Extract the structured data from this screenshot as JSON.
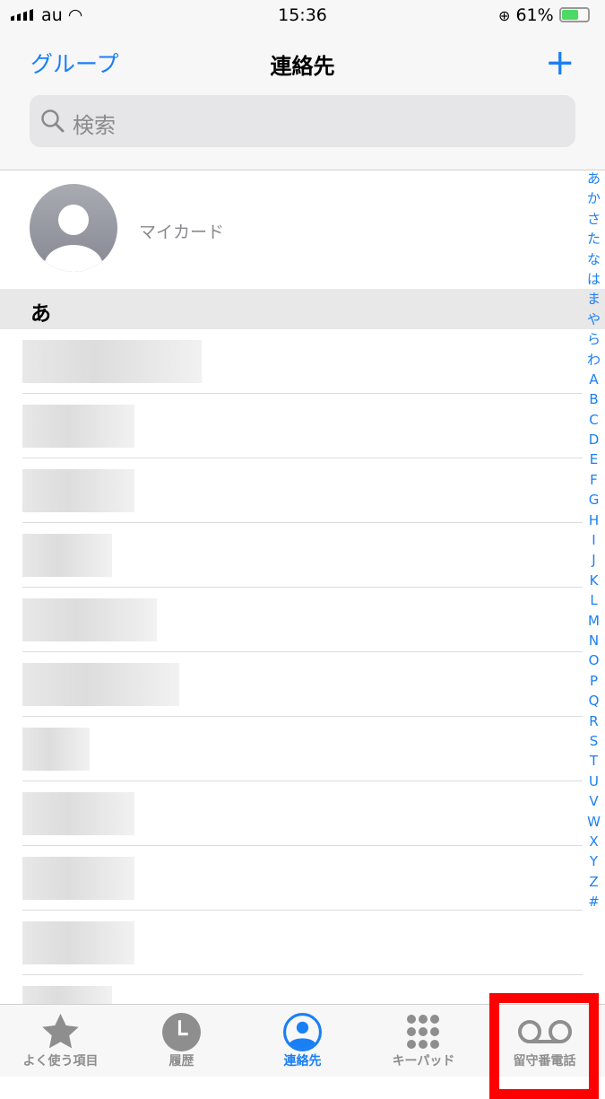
{
  "status": {
    "carrier": "au",
    "time": "15:36",
    "battery": "61%"
  },
  "nav": {
    "left": "グループ",
    "title": "連絡先",
    "add_icon": "plus-icon"
  },
  "search": {
    "placeholder": "検索"
  },
  "my_card": {
    "label": "マイカード"
  },
  "section": "あ",
  "index": [
    "あ",
    "か",
    "さ",
    "た",
    "な",
    "は",
    "ま",
    "や",
    "ら",
    "わ",
    "A",
    "B",
    "C",
    "D",
    "E",
    "F",
    "G",
    "H",
    "I",
    "J",
    "K",
    "L",
    "M",
    "N",
    "O",
    "P",
    "Q",
    "R",
    "S",
    "T",
    "U",
    "V",
    "W",
    "X",
    "Y",
    "Z",
    "#"
  ],
  "tabs": [
    {
      "label": "よく使う項目",
      "icon": "star-icon"
    },
    {
      "label": "履歴",
      "icon": "clock-icon"
    },
    {
      "label": "連絡先",
      "icon": "person-circle-icon",
      "active": true
    },
    {
      "label": "キーパッド",
      "icon": "keypad-icon"
    },
    {
      "label": "留守番電話",
      "icon": "voicemail-icon"
    }
  ],
  "colors": {
    "accent": "#1a7ff5",
    "highlight": "#ff0000"
  }
}
